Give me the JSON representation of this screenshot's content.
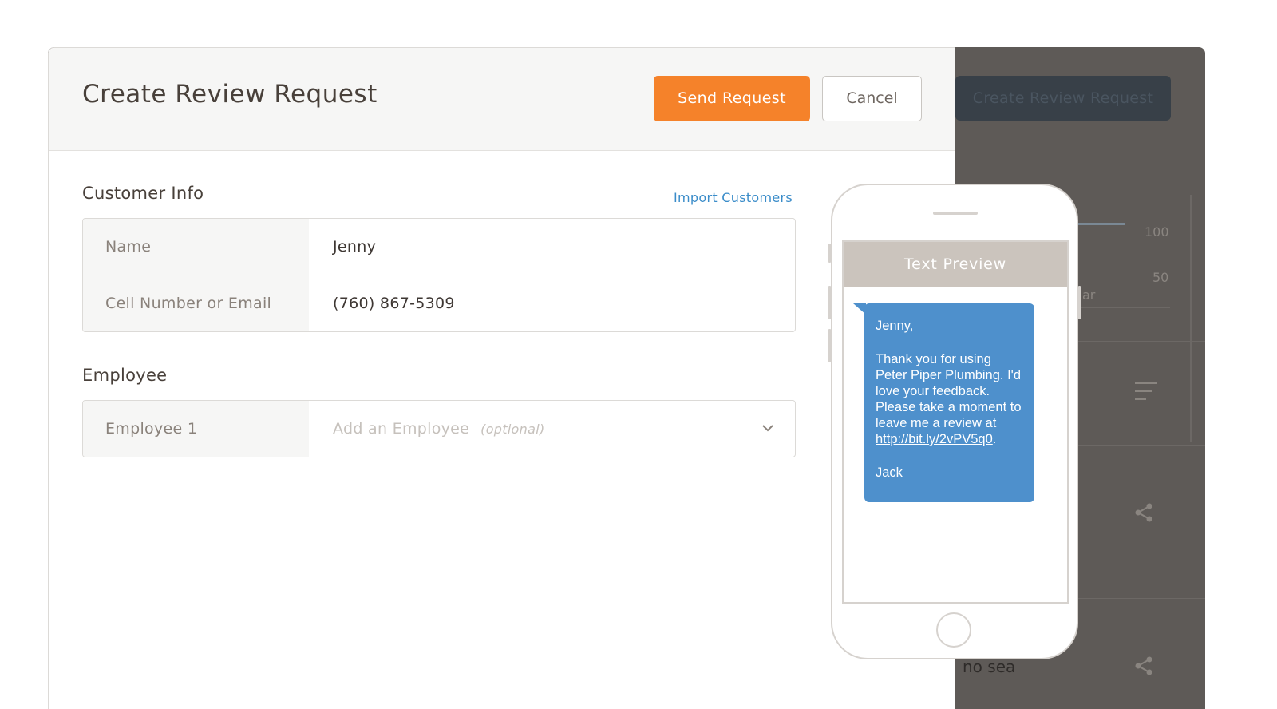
{
  "background_app": {
    "button_label": "Create Review Request",
    "axis_labels": [
      "100",
      "50"
    ],
    "partial_text_1": "ar",
    "partial_text_2": "no sea",
    "icons": [
      "menu-icon",
      "share-icon"
    ]
  },
  "modal": {
    "title": "Create Review Request",
    "send_label": "Send Request",
    "cancel_label": "Cancel",
    "send_color": "#f5822a"
  },
  "customer_info": {
    "title": "Customer Info",
    "import_link": "Import Customers",
    "fields": [
      {
        "label": "Name",
        "value": "Jenny"
      },
      {
        "label": "Cell Number or Email",
        "value": "(760) 867-5309"
      }
    ]
  },
  "employee": {
    "title": "Employee",
    "field_label": "Employee 1",
    "placeholder": "Add an Employee",
    "optional_hint": "(optional)"
  },
  "preview": {
    "header": "Text Preview",
    "greeting": "Jenny,",
    "body_before_link": "Thank you for using Peter Piper Plumbing. I'd love your feedback. Please take a moment to leave me a review at ",
    "link": "http://bit.ly/2vPV5q0",
    "body_after_link": ".",
    "signature": "Jack",
    "bubble_color": "#4e90cc"
  }
}
